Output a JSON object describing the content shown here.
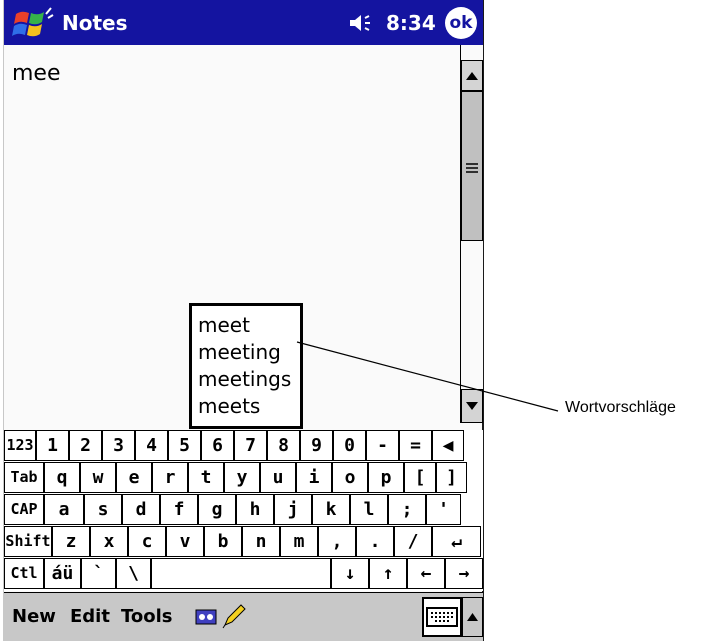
{
  "titlebar": {
    "app_title": "Notes",
    "clock": "8:34",
    "ok_label": "ok",
    "bg_color": "#1414a0",
    "start_icon": "windows-flag-icon",
    "volume_icon": "speaker-icon"
  },
  "note": {
    "text": "mee"
  },
  "suggestions": {
    "items": [
      "meet",
      "meeting",
      "meetings",
      "meets"
    ]
  },
  "keyboard": {
    "rows": [
      [
        "123",
        "1",
        "2",
        "3",
        "4",
        "5",
        "6",
        "7",
        "8",
        "9",
        "0",
        "-",
        "=",
        "◀"
      ],
      [
        "Tab",
        "q",
        "w",
        "e",
        "r",
        "t",
        "y",
        "u",
        "i",
        "o",
        "p",
        "[",
        "]"
      ],
      [
        "CAP",
        "a",
        "s",
        "d",
        "f",
        "g",
        "h",
        "j",
        "k",
        "l",
        ";",
        "'"
      ],
      [
        "Shift",
        "z",
        "x",
        "c",
        "v",
        "b",
        "n",
        "m",
        ",",
        ".",
        "/",
        "↵"
      ],
      [
        "Ctl",
        "áü",
        "`",
        "\\",
        "",
        "↓",
        "↑",
        "←",
        "→"
      ]
    ]
  },
  "commandbar": {
    "menus": [
      "New",
      "Edit",
      "Tools"
    ],
    "icons": [
      "recorder-icon",
      "pen-icon",
      "keyboard-icon",
      "up-arrow-icon"
    ]
  },
  "callout": {
    "label": "Wortvorschläge"
  }
}
